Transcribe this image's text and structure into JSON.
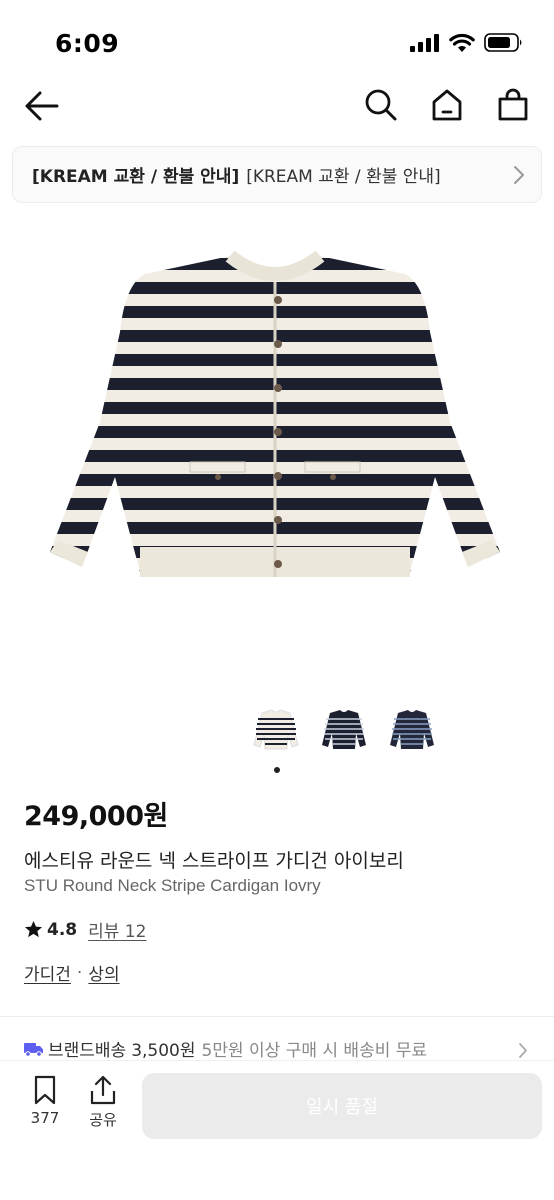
{
  "status": {
    "time": "6:09"
  },
  "notice": {
    "bold_text": "[KREAM 교환 / 환불 안내]",
    "normal_text": "[KREAM 교환 / 환불 안내]"
  },
  "product": {
    "price": "249,000원",
    "name_ko": "에스티유 라운드 넥 스트라이프 가디건 아이보리",
    "name_en": "STU Round Neck Stripe Cardigan Iovry",
    "rating": "4.8",
    "review_label": "리뷰 12",
    "categories": [
      "가디건",
      "상의"
    ],
    "category_separator": "·",
    "colors": {
      "ivory": "#f1ede4",
      "navy": "#1c1f2e"
    }
  },
  "shipping": {
    "label": "브랜드배송",
    "fee": "3,500원",
    "note": "5만원 이상 구매 시 배송비 무료"
  },
  "bottom_bar": {
    "bookmark_count": "377",
    "share_label": "공유",
    "soldout_label": "일시 품절"
  },
  "theme": {
    "accent": "#5d5fef",
    "disabled": "#ebebeb"
  }
}
